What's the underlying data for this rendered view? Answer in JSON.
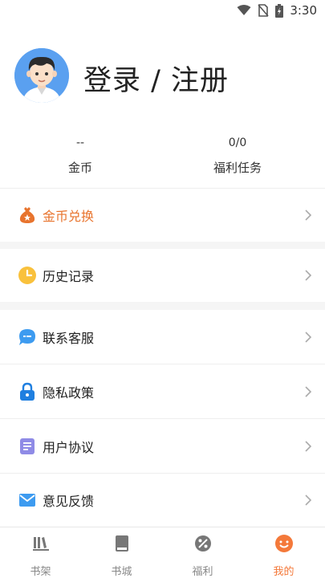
{
  "status_bar": {
    "time": "3:30",
    "icons": [
      "wifi-icon",
      "no-sim-icon",
      "battery-charging-icon"
    ]
  },
  "profile": {
    "login_text": "登录 / 注册",
    "avatar": "user-avatar"
  },
  "stats": [
    {
      "value": "--",
      "label": "金币"
    },
    {
      "value": "0/0",
      "label": "福利任务"
    }
  ],
  "menu": {
    "coin_exchange": {
      "label": "金币兑换",
      "color": "#e8742e"
    },
    "history": {
      "label": "历史记录"
    },
    "contact": {
      "label": "联系客服"
    },
    "privacy": {
      "label": "隐私政策"
    },
    "agreement": {
      "label": "用户协议"
    },
    "feedback": {
      "label": "意见反馈"
    }
  },
  "tabs": [
    {
      "label": "书架",
      "icon": "bookshelf-icon"
    },
    {
      "label": "书城",
      "icon": "book-store-icon"
    },
    {
      "label": "福利",
      "icon": "welfare-icon"
    },
    {
      "label": "我的",
      "icon": "smile-icon",
      "active": true
    }
  ],
  "colors": {
    "accent": "#f4793a",
    "background": "#f5f5f5"
  }
}
